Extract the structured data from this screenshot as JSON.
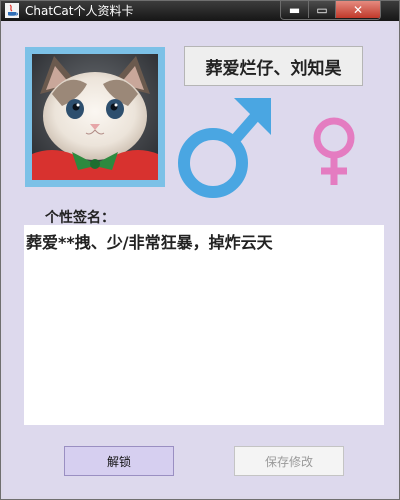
{
  "window": {
    "title": "ChatCat个人资料卡",
    "controls": {
      "minimize": "▬",
      "maximize": "▭",
      "close": "✕"
    }
  },
  "profile": {
    "name": "葬爱烂仔、刘知昊",
    "gender_icons": {
      "male": "male-symbol",
      "female": "female-symbol"
    },
    "colors": {
      "male": "#4aa6e2",
      "female": "#e47cc1",
      "avatar_border": "#7cc1e7"
    }
  },
  "signature": {
    "label": "个性签名：",
    "text": "葬爱**拽、少/非常狂暴，掉炸云天"
  },
  "buttons": {
    "unlock": "解锁",
    "save": "保存修改"
  }
}
